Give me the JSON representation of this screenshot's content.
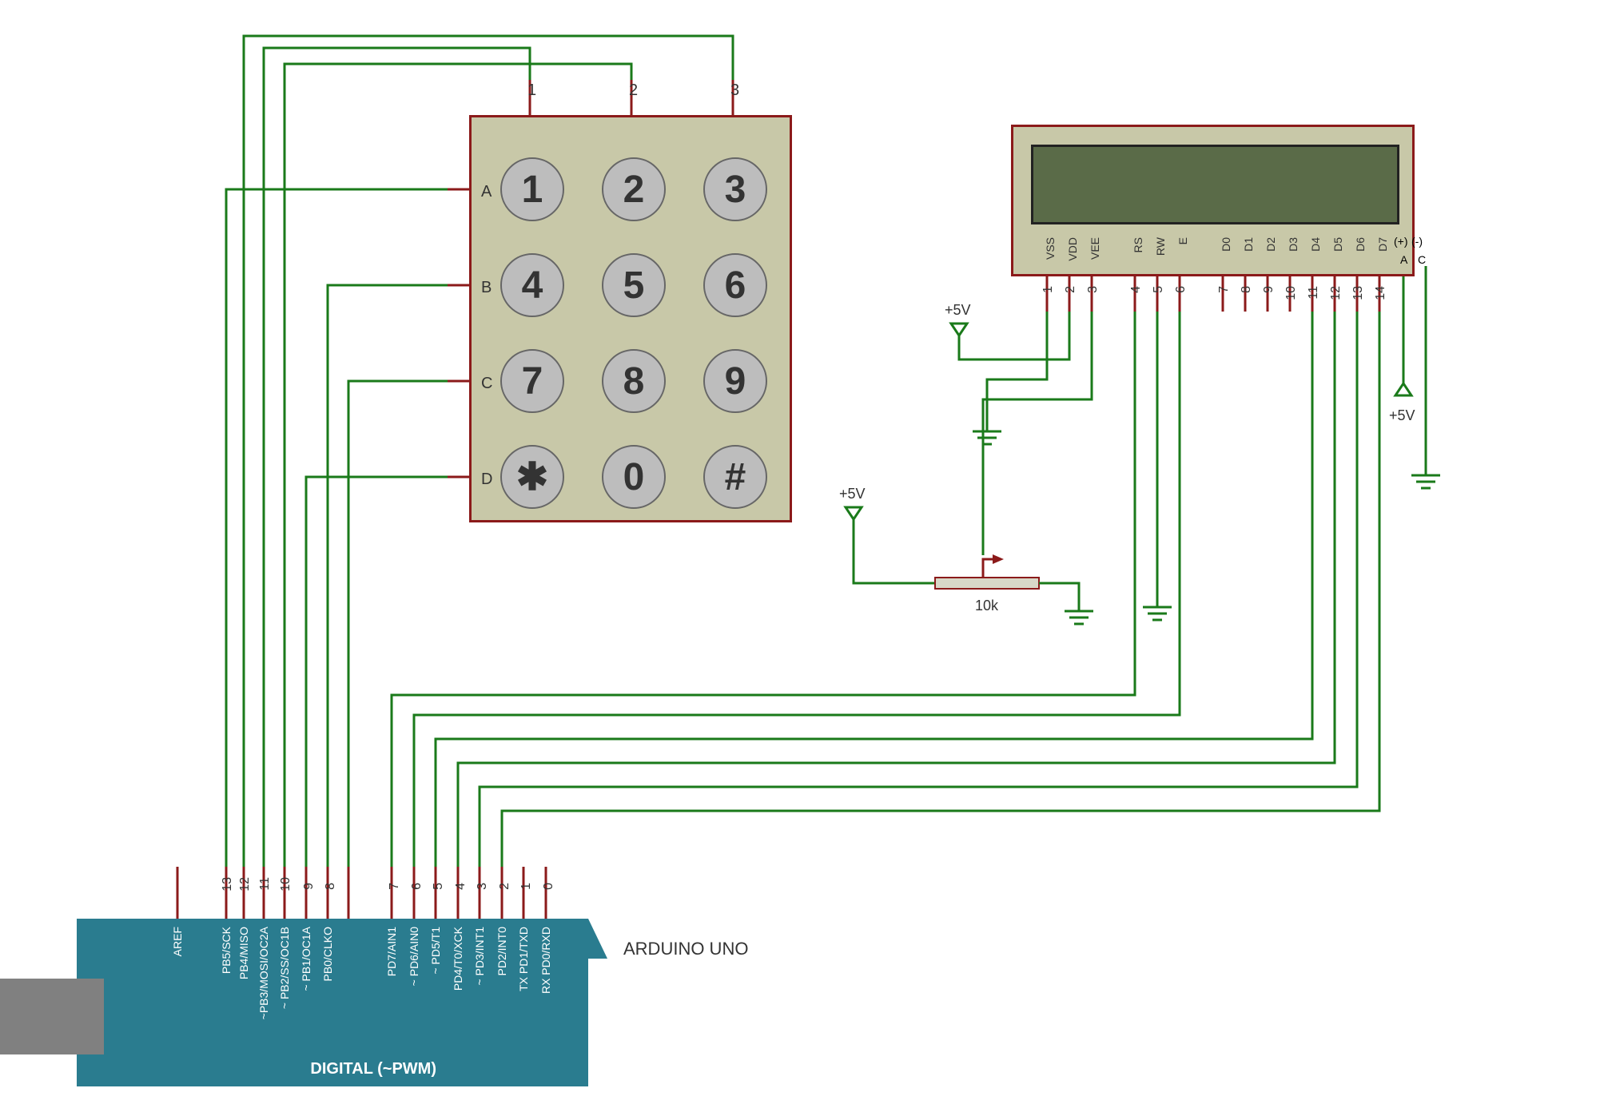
{
  "keypad": {
    "cols": [
      "1",
      "2",
      "3"
    ],
    "rows": [
      "A",
      "B",
      "C",
      "D"
    ],
    "keys": [
      [
        "1",
        "2",
        "3"
      ],
      [
        "4",
        "5",
        "6"
      ],
      [
        "7",
        "8",
        "9"
      ],
      [
        "✱",
        "0",
        "#"
      ]
    ]
  },
  "lcd": {
    "pin_labels": [
      "VSS",
      "VDD",
      "VEE",
      "RS",
      "RW",
      "E",
      "D0",
      "D1",
      "D2",
      "D3",
      "D4",
      "D5",
      "D6",
      "D7"
    ],
    "pin_extra": [
      "(+)",
      "(-)"
    ],
    "pin_extra2": [
      "A",
      "C"
    ],
    "pin_nums": [
      "1",
      "2",
      "3",
      "4",
      "5",
      "6",
      "7",
      "8",
      "9",
      "10",
      "11",
      "12",
      "13",
      "14"
    ]
  },
  "arduino": {
    "name": "ARDUINO UNO",
    "digital_label": "DIGITAL (~PWM)",
    "pins": {
      "aref": "AREF",
      "p13": "PB5/SCK",
      "n13": "13",
      "p12": "PB4/MISO",
      "n12": "12",
      "p11": "~PB3/MOSI/OC2A",
      "n11": "11",
      "p10": "~ PB2/SS/OC1B",
      "n10": "10",
      "p9": "~ PB1/OC1A",
      "n9": "9",
      "p8": "PB0/CLKO",
      "n8": "8",
      "p7": "PD7/AIN1",
      "n7": "7",
      "p6": "~ PD6/AIN0",
      "n6": "6",
      "p5": "~ PD5/T1",
      "n5": "5",
      "p4": "PD4/T0/XCK",
      "n4": "4",
      "p3": "~ PD3/INT1",
      "n3": "3",
      "p2": "PD2/INT0",
      "n2": "2",
      "p1": "TX PD1/TXD",
      "n1": "1",
      "p0": "RX PD0/RXD",
      "n0": "0"
    }
  },
  "power": {
    "p5v_1": "+5V",
    "p5v_2": "+5V",
    "p5v_3": "+5V"
  },
  "pot": {
    "value": "10k"
  }
}
